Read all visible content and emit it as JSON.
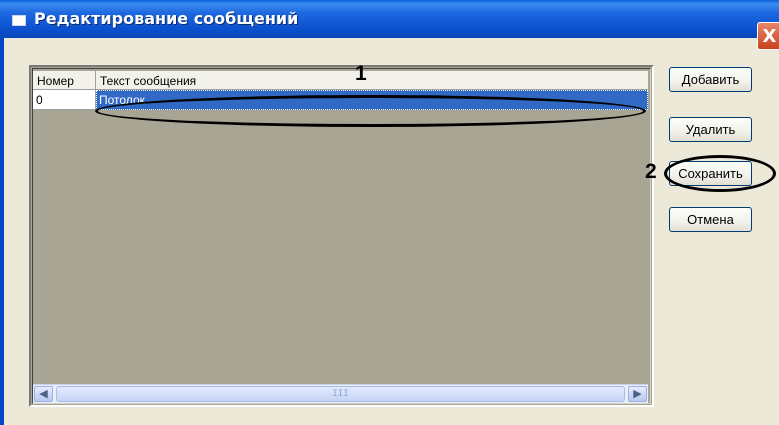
{
  "window": {
    "title": "Редактирование сообщений",
    "close_glyph": "X"
  },
  "table": {
    "columns": [
      "Номер",
      "Текст сообщения"
    ],
    "rows": [
      {
        "number": "0",
        "text": "Потолок"
      }
    ],
    "scroll_thumb_grip": "III"
  },
  "buttons": {
    "add": "Добавить",
    "delete": "Удалить",
    "save": "Сохранить",
    "cancel": "Отмена"
  },
  "annotations": {
    "one": "1",
    "two": "2"
  },
  "icons": {
    "scroll_left": "scroll-left-arrow-icon",
    "scroll_right": "scroll-right-arrow-icon",
    "app": "window-app-icon",
    "close": "close-icon"
  },
  "colors": {
    "titlebar": "#0a4fcc",
    "selection": "#316ac5",
    "grid_background": "#a9a595",
    "dialog_background": "#ece9d8",
    "close_button": "#c8431d"
  }
}
